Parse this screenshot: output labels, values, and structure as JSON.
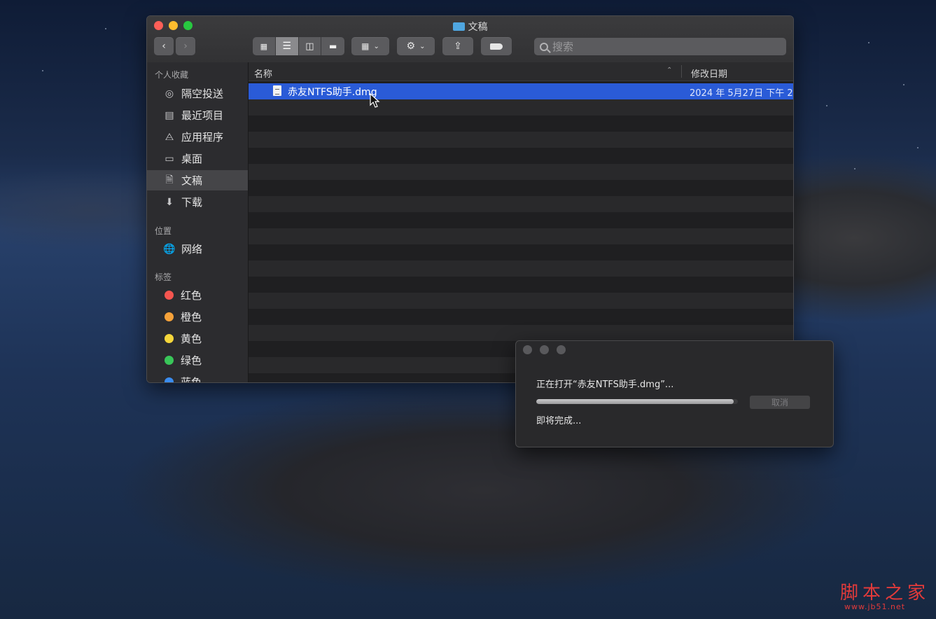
{
  "finder": {
    "title": "文稿",
    "search_placeholder": "搜索",
    "sidebar": {
      "favorites_header": "个人收藏",
      "favorites": [
        {
          "label": "隔空投送",
          "icon": "airdrop-icon"
        },
        {
          "label": "最近项目",
          "icon": "recents-icon"
        },
        {
          "label": "应用程序",
          "icon": "applications-icon"
        },
        {
          "label": "桌面",
          "icon": "desktop-icon"
        },
        {
          "label": "文稿",
          "icon": "documents-icon"
        },
        {
          "label": "下载",
          "icon": "downloads-icon"
        }
      ],
      "locations_header": "位置",
      "locations": [
        {
          "label": "网络",
          "icon": "network-icon"
        }
      ],
      "tags_header": "标签",
      "tags": [
        {
          "label": "红色",
          "color": "#f5554f"
        },
        {
          "label": "橙色",
          "color": "#f6a23a"
        },
        {
          "label": "黄色",
          "color": "#f5d63b"
        },
        {
          "label": "绿色",
          "color": "#39c659"
        },
        {
          "label": "蓝色",
          "color": "#3a8cf0"
        }
      ]
    },
    "columns": {
      "name": "名称",
      "date": "修改日期"
    },
    "files": [
      {
        "name": "赤友NTFS助手.dmg",
        "date": "2024 年 5月27日 下午 2",
        "selected": true
      }
    ]
  },
  "dialog": {
    "message": "正在打开“赤友NTFS助手.dmg”...",
    "progress": 0.98,
    "cancel_label": "取消",
    "status": "即将完成..."
  },
  "watermark": {
    "text": "脚本之家",
    "url": "www.jb51.net"
  }
}
